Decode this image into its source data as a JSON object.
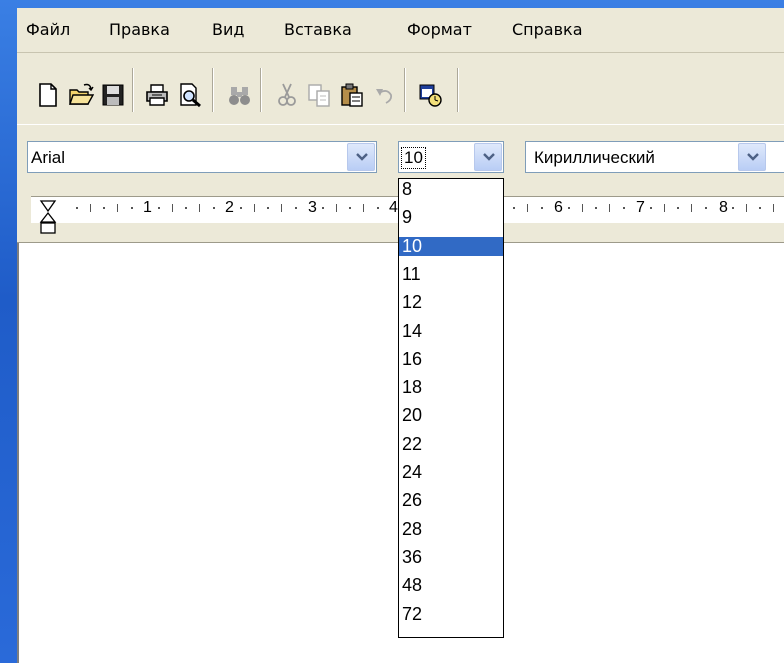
{
  "menu": [
    "Файл",
    "Правка",
    "Вид",
    "Вставка",
    "Формат",
    "Справка"
  ],
  "toolbar": {
    "icons": [
      "new-document-icon",
      "open-folder-icon",
      "save-disk-icon",
      "print-icon",
      "print-preview-icon",
      "find-binoculars-icon",
      "cut-scissors-icon",
      "copy-icon",
      "paste-icon",
      "undo-icon",
      "date-time-icon"
    ]
  },
  "format": {
    "font_name": "Arial",
    "font_size": "10",
    "script": "Кириллический"
  },
  "ruler": {
    "numbers": [
      "1",
      "2",
      "3",
      "4",
      "6",
      "7",
      "8"
    ]
  },
  "size_dropdown": {
    "options": [
      "8",
      "9",
      "10",
      "11",
      "12",
      "14",
      "16",
      "18",
      "20",
      "22",
      "24",
      "26",
      "28",
      "36",
      "48",
      "72"
    ],
    "selected": "10"
  },
  "colors": {
    "selection": "#316ac5",
    "desktop": "#2b6fd6",
    "chrome": "#ece9d8",
    "combo_border": "#7f9db9"
  }
}
